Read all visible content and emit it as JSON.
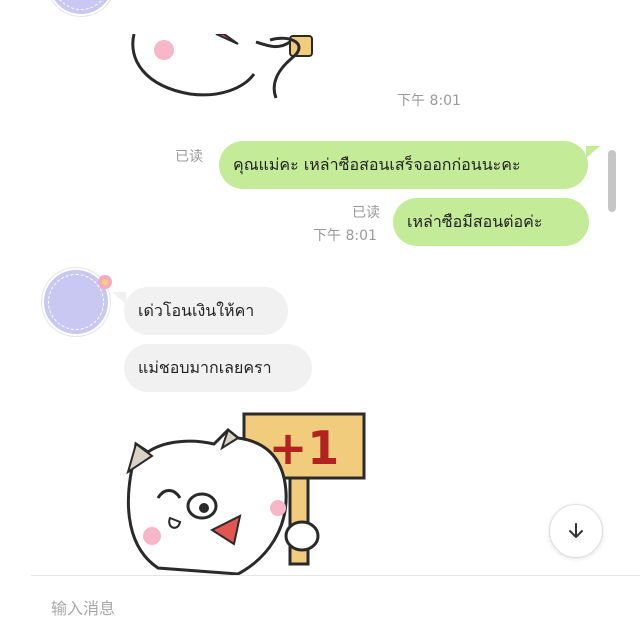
{
  "messages": {
    "time_first": "下午 8:01",
    "out": [
      {
        "read": "已读",
        "text": "คุณแม่คะ เหล่าซือสอนเสร็จออกก่อนนะคะ"
      },
      {
        "read": "已读",
        "time": "下午 8:01",
        "text": "เหล่าซือมีสอนต่อค่ะ"
      }
    ],
    "in": [
      {
        "text": "เด่วโอนเงินให้คา"
      },
      {
        "text": "แม่ชอบมากเลยครา"
      }
    ],
    "sticker_top": {
      "icon": "cat-sticker-icon"
    },
    "sticker_bottom": {
      "icon": "cat-plus-one-sticker-icon",
      "sign_text": "+1"
    }
  },
  "controls": {
    "scroll_down_icon": "arrow-down-icon"
  },
  "composer": {
    "placeholder": "输入消息",
    "value": ""
  },
  "colors": {
    "outgoing_bubble": "#c4eb98",
    "incoming_bubble": "#f1f1f1",
    "avatar": "#c9c8f2"
  }
}
